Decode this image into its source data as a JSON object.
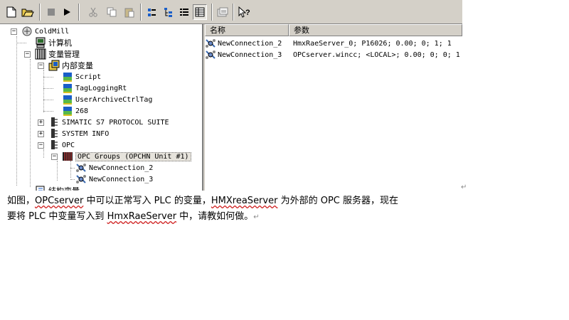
{
  "toolbar": {
    "buttons": [
      {
        "icon": "new-file-icon"
      },
      {
        "icon": "open-folder-icon"
      },
      {
        "icon": "stop-icon"
      },
      {
        "icon": "run-icon"
      },
      {
        "icon": "cut-icon"
      },
      {
        "icon": "copy-icon"
      },
      {
        "icon": "paste-icon"
      },
      {
        "icon": "small-icons-view-icon"
      },
      {
        "icon": "tree-view-icon"
      },
      {
        "icon": "list-view-icon"
      },
      {
        "icon": "details-view-icon"
      },
      {
        "icon": "properties-icon"
      },
      {
        "icon": "help-icon"
      }
    ]
  },
  "tree": {
    "root": "ColdMill",
    "computer": "计算机",
    "tag_management": "变量管理",
    "internal_tags": "内部变量",
    "internal_items": [
      "Script",
      "TagLoggingRt",
      "UserArchiveCtrlTag",
      "268"
    ],
    "simatic": "SIMATIC S7 PROTOCOL SUITE",
    "system_info": "SYSTEM INFO",
    "opc": "OPC",
    "opc_groups": "OPC Groups (OPCHN Unit #1)",
    "connections": [
      "NewConnection_2",
      "NewConnection_3"
    ],
    "struct_tags": "结构变量"
  },
  "list": {
    "columns": [
      "名称",
      "参数"
    ],
    "rows": [
      {
        "name": "NewConnection_2",
        "params": "HmxRaeServer_0; P16026; 0.00; 0; 1; 1"
      },
      {
        "name": "NewConnection_3",
        "params": "OPCserver.wincc; <LOCAL>; 0.00; 0; 0; 1"
      }
    ]
  },
  "caption": {
    "l1_a": "如图，",
    "l1_b": "OPCserver",
    "l1_c": " 中可以正常写入 PLC 的变量，",
    "l1_d": "HMXreaServer",
    "l1_e": " 为外部的 OPC 服务器，现在",
    "l2_a": "要将 PLC 中变量写入到 ",
    "l2_b": "HmxRaeServer",
    "l2_c": " 中，请教如何做。",
    "para_mark": "↵"
  },
  "colors": {
    "window_bg": "#d4d0c8",
    "selection": "#e6e3dc",
    "squiggle": "#d02020"
  }
}
